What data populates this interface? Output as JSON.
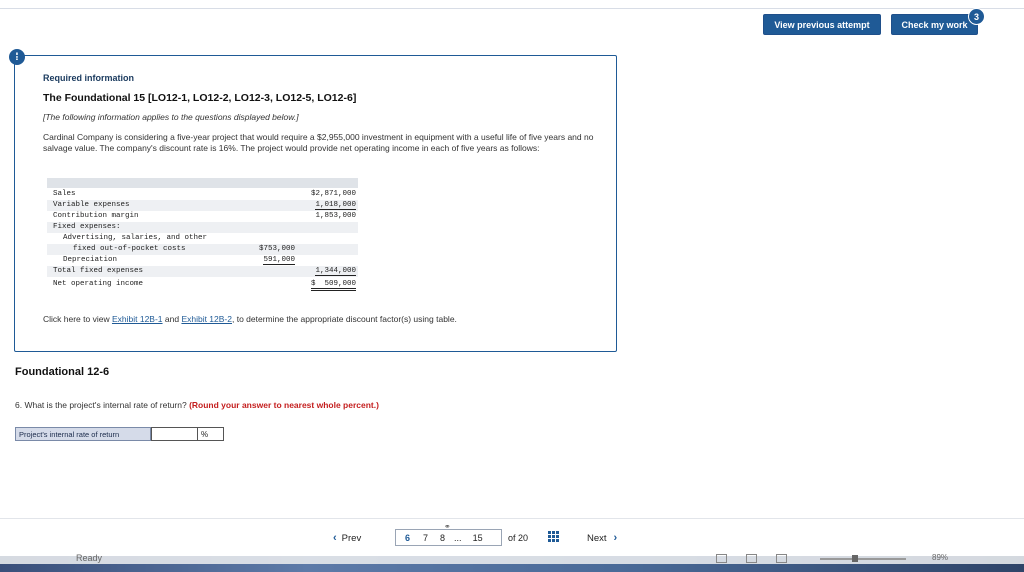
{
  "header": {
    "view_previous_label": "View previous attempt",
    "check_work_label": "Check my work",
    "check_badge": "3"
  },
  "alert_icon": "!",
  "info": {
    "title": "Required information",
    "subtitle": "The Foundational 15 [LO12-1, LO12-2, LO12-3, LO12-5, LO12-6]",
    "note": "[The following information applies to the questions displayed below.]",
    "paragraph": "Cardinal Company is considering a five-year project that would require a $2,955,000 investment in equipment with a useful life of five years and no salvage value. The company's discount rate is 16%. The project would provide net operating income in each of five years as follows:",
    "table": [
      {
        "label": "Sales",
        "v1": "",
        "v2": "$2,871,000"
      },
      {
        "label": "Variable expenses",
        "v1": "",
        "v2": "1,018,000"
      },
      {
        "label": "Contribution margin",
        "v1": "",
        "v2": "1,853,000"
      },
      {
        "label": "Fixed expenses:",
        "v1": "",
        "v2": ""
      },
      {
        "label": "Advertising, salaries, and other",
        "v1": "",
        "v2": ""
      },
      {
        "label": "fixed out-of-pocket costs",
        "v1": "$753,000",
        "v2": ""
      },
      {
        "label": "Depreciation",
        "v1": "591,000",
        "v2": ""
      },
      {
        "label": "Total fixed expenses",
        "v1": "",
        "v2": "1,344,000"
      },
      {
        "label": "Net operating income",
        "v1": "",
        "v2": "$  509,000"
      }
    ],
    "click_prefix": "Click here to view ",
    "exhibit1": "Exhibit 12B-1",
    "click_and": " and ",
    "exhibit2": "Exhibit 12B-2",
    "click_suffix": ", to determine the appropriate discount factor(s) using table."
  },
  "section_heading": "Foundational 12-6",
  "question": {
    "text": "6. What is the project's internal rate of return? ",
    "hint": "(Round your answer to nearest whole percent.)",
    "answer_label": "Project's internal rate of return",
    "answer_value": "",
    "unit": "%"
  },
  "nav": {
    "prev_label": "Prev",
    "pages": [
      "6",
      "7",
      "8",
      "...",
      "15"
    ],
    "of_label": "of 20",
    "next_label": "Next"
  },
  "statusbar": {
    "ready": "Ready",
    "zoom": "89%"
  }
}
